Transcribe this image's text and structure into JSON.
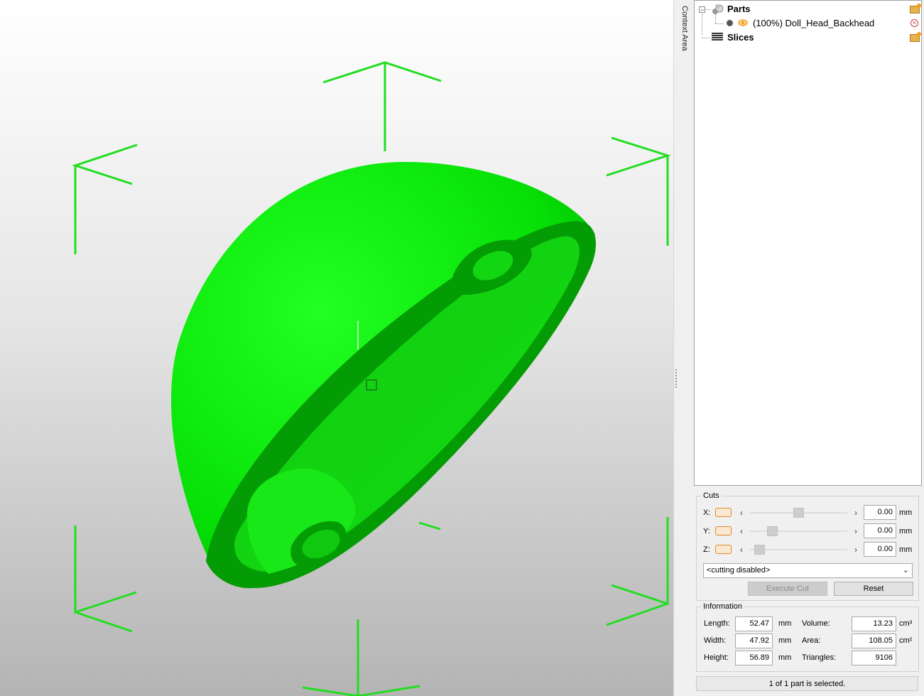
{
  "viewport": {
    "model_color": "#00ff00",
    "bbox_color": "#22dd22",
    "cursor_marker": "square-cursor-icon"
  },
  "context_strip": {
    "label": "Context Area"
  },
  "tree": {
    "parts": {
      "label": "Parts",
      "expander": "−",
      "icon": "parts-icon",
      "action_icon": "open-folder-icon",
      "items": [
        {
          "label": "(100%) Doll_Head_Backhead",
          "dot_color": "#555555",
          "eye_color": "#f29a1a",
          "remove_icon": "remove-icon"
        }
      ]
    },
    "slices": {
      "label": "Slices",
      "icon": "slices-icon",
      "action_icon": "open-folder-icon"
    }
  },
  "cuts": {
    "title": "Cuts",
    "rows": [
      {
        "axis": "X:",
        "value": "0.00",
        "unit": "mm",
        "thumb": 0.5
      },
      {
        "axis": "Y:",
        "value": "0.00",
        "unit": "mm",
        "thumb": 0.2
      },
      {
        "axis": "Z:",
        "value": "0.00",
        "unit": "mm",
        "thumb": 0.05
      }
    ],
    "mode": "<cutting disabled>",
    "execute_label": "Execute Cut",
    "reset_label": "Reset"
  },
  "information": {
    "title": "Information",
    "length_label": "Length:",
    "length_value": "52.47",
    "length_unit": "mm",
    "width_label": "Width:",
    "width_value": "47.92",
    "width_unit": "mm",
    "height_label": "Height:",
    "height_value": "56.89",
    "height_unit": "mm",
    "volume_label": "Volume:",
    "volume_value": "13.23",
    "volume_unit": "cm³",
    "area_label": "Area:",
    "area_value": "108.05",
    "area_unit": "cm²",
    "triangles_label": "Triangles:",
    "triangles_value": "9106"
  },
  "status": {
    "text": "1 of 1 part is selected."
  }
}
